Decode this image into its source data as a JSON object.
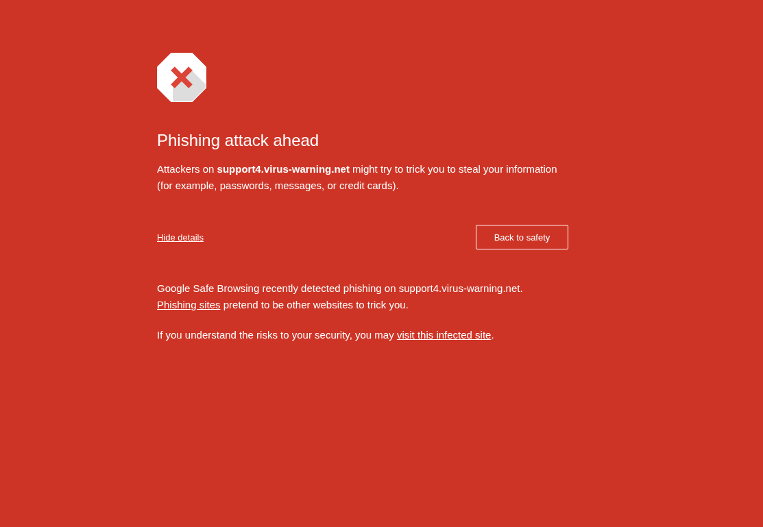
{
  "heading": "Phishing attack ahead",
  "main_message": "Attackers on **support4.virus-warning.net** might try to trick you to steal your information (for example, passwords, messages, or credit cards).",
  "details_link": "Hide details",
  "primary_button": "Back to safety",
  "details": {
    "expanded": true,
    "paragraphs": [
      {
        "segments": [
          {
            "kind": "text",
            "text": "Google Safe Browsing recently detected phishing on support4.virus-warning.net. "
          },
          {
            "kind": "link",
            "text": "Phishing sites"
          },
          {
            "kind": "text",
            "text": " pretend to be other websites to trick you."
          }
        ]
      },
      {
        "segments": [
          {
            "kind": "text",
            "text": "If you understand the risks to your security, you may "
          },
          {
            "kind": "link",
            "text": "visit this infected site"
          },
          {
            "kind": "text",
            "text": "."
          }
        ]
      }
    ]
  }
}
